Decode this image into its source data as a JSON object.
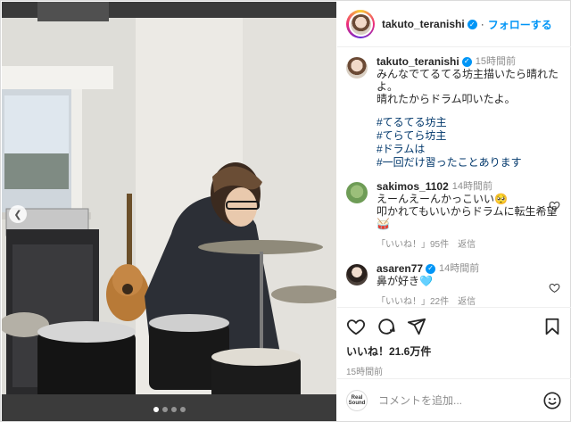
{
  "post": {
    "author": "takuto_teranishi",
    "follow_label": "フォローする",
    "caption_time": "15時間前",
    "caption_lines": [
      "みんなでてるてる坊主描いたら晴れたよ。",
      "晴れたからドラム叩いたよ。"
    ],
    "hashtags": [
      "#てるてる坊主",
      "#てらてら坊主",
      "#ドラムは",
      "#一回だけ習ったことあります"
    ],
    "likes": "いいね！21.6万件",
    "posted_time": "15時間前",
    "photo_page": 1,
    "photo_pages": 4
  },
  "comments": [
    {
      "user": "sakimos_1102",
      "verified": false,
      "time": "14時間前",
      "text": "えーんえーんかっこいい🥺\n叩かれてもいいからドラムに転生希望🥁",
      "likes": "「いいね！」95件",
      "reply": "返信"
    },
    {
      "user": "asaren77",
      "verified": true,
      "time": "14時間前",
      "text": "鼻が好き🩵",
      "likes": "「いいね！」22件",
      "reply": "返信"
    }
  ],
  "composer": {
    "account_label": "Real Sound",
    "placeholder": "コメントを追加..."
  },
  "icons": {
    "verified": "verified-badge-icon",
    "like": "heart-icon",
    "comment": "comment-bubble-icon",
    "share": "paper-plane-icon",
    "save": "bookmark-icon",
    "emoji": "smiley-icon",
    "more": "more-horizontal-icon",
    "prev": "chevron-left-icon"
  },
  "colors": {
    "accent": "#0095f6",
    "hashtag": "#00376b",
    "muted": "#8e8e8e"
  }
}
